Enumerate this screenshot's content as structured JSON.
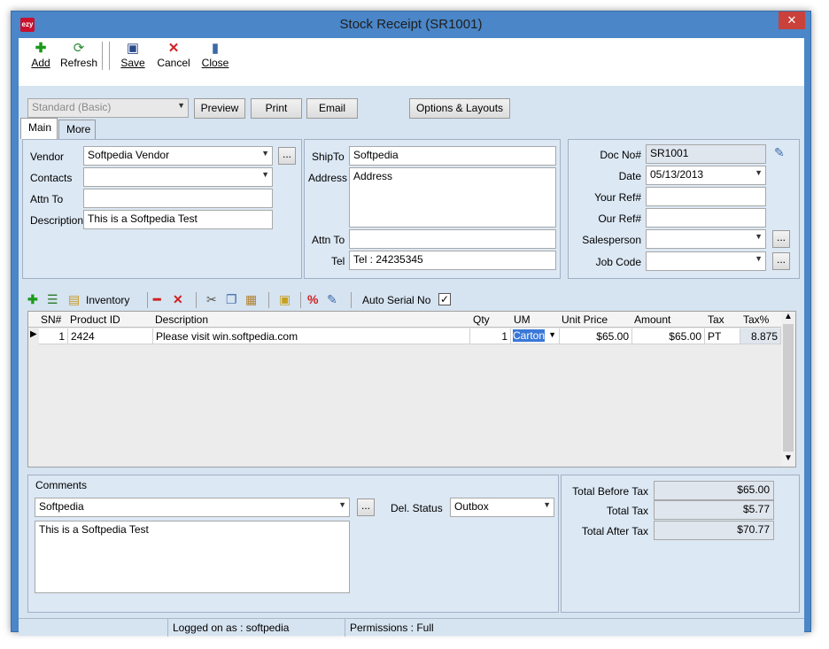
{
  "window": {
    "title": "Stock Receipt (SR1001)",
    "app_icon_text": "ezy",
    "close_glyph": "✕"
  },
  "toolbar": {
    "add": "Add",
    "refresh": "Refresh",
    "save": "Save",
    "cancel": "Cancel",
    "close": "Close"
  },
  "bar2": {
    "layout_select": "Standard (Basic)",
    "preview": "Preview",
    "print": "Print",
    "email": "Email",
    "options": "Options & Layouts"
  },
  "tabs": {
    "main": "Main",
    "more": "More"
  },
  "vendor_panel": {
    "vendor_label": "Vendor",
    "vendor_value": "Softpedia Vendor",
    "contacts_label": "Contacts",
    "contacts_value": "",
    "attn_label": "Attn To",
    "attn_value": "",
    "desc_label": "Description",
    "desc_value": "This is a Softpedia Test",
    "browse": "..."
  },
  "ship_panel": {
    "shipto_label": "ShipTo",
    "shipto_value": "Softpedia",
    "address_label": "Address",
    "address_value": "Address",
    "attn_label": "Attn To",
    "attn_value": "",
    "tel_label": "Tel",
    "tel_value": "Tel : 24235345"
  },
  "doc_panel": {
    "docno_label": "Doc No#",
    "docno_value": "SR1001",
    "date_label": "Date",
    "date_value": "05/13/2013",
    "yourref_label": "Your Ref#",
    "yourref_value": "",
    "ourref_label": "Our Ref#",
    "ourref_value": "",
    "sales_label": "Salesperson",
    "sales_value": "",
    "job_label": "Job Code",
    "job_value": "",
    "browse": "..."
  },
  "grid_toolbar": {
    "inventory": "Inventory",
    "auto_serial": "Auto Serial No",
    "auto_serial_checked": true
  },
  "grid": {
    "columns": [
      "SN#",
      "Product ID",
      "Description",
      "Qty",
      "UM",
      "Unit Price",
      "Amount",
      "Tax",
      "Tax%"
    ],
    "rows": [
      {
        "sn": "1",
        "product": "2424",
        "description": "Please visit win.softpedia.com",
        "qty": "1",
        "um": "Carton",
        "unit_price": "$65.00",
        "amount": "$65.00",
        "tax": "PT",
        "taxpct": "8.875"
      }
    ]
  },
  "comments": {
    "label": "Comments",
    "value": "Softpedia",
    "text": "This is a Softpedia Test",
    "del_label": "Del. Status",
    "del_value": "Outbox",
    "browse": "..."
  },
  "totals": {
    "before_label": "Total Before Tax",
    "before_value": "$65.00",
    "tax_label": "Total Tax",
    "tax_value": "$5.77",
    "after_label": "Total After Tax",
    "after_value": "$70.77"
  },
  "status": {
    "logged": "Logged on as : softpedia",
    "perm": "Permissions : Full"
  }
}
